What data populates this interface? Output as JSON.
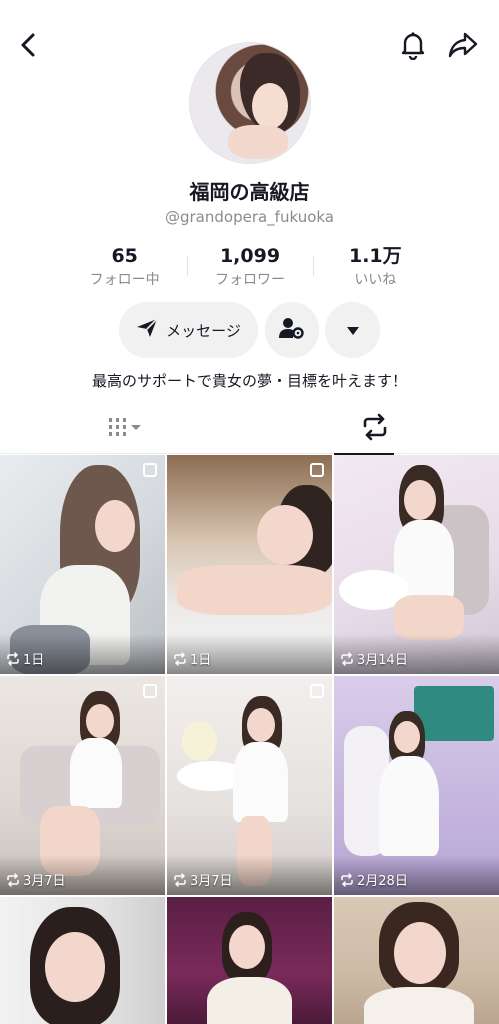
{
  "header": {
    "back_icon": "chevron-left-icon",
    "bell_icon": "bell-icon",
    "share_icon": "share-arrow-icon"
  },
  "profile": {
    "display_name": "福岡の高級店",
    "username": "@grandopera_fukuoka",
    "bio": "最高のサポートで貴女の夢・目標を叶えます！"
  },
  "stats": [
    {
      "value": "65",
      "label": "フォロー中"
    },
    {
      "value": "1,099",
      "label": "フォロワー"
    },
    {
      "value": "1.1万",
      "label": "いいね"
    }
  ],
  "actions": {
    "message_label": "メッセージ",
    "message_icon": "send-icon",
    "subscribe_icon": "person-gear-icon",
    "more_icon": "caret-down-icon"
  },
  "tabs": {
    "videos_icon": "grid-bars-icon",
    "reposts_icon": "repost-icon",
    "active": "reposts"
  },
  "grid": [
    {
      "date": "1日",
      "multi": true
    },
    {
      "date": "1日",
      "multi": true
    },
    {
      "date": "3月14日",
      "multi": false
    },
    {
      "date": "3月7日",
      "multi": true
    },
    {
      "date": "3月7日",
      "multi": true
    },
    {
      "date": "2月28日",
      "multi": false
    },
    {
      "date": "",
      "multi": false
    },
    {
      "date": "",
      "multi": false
    },
    {
      "date": "",
      "multi": false
    }
  ]
}
